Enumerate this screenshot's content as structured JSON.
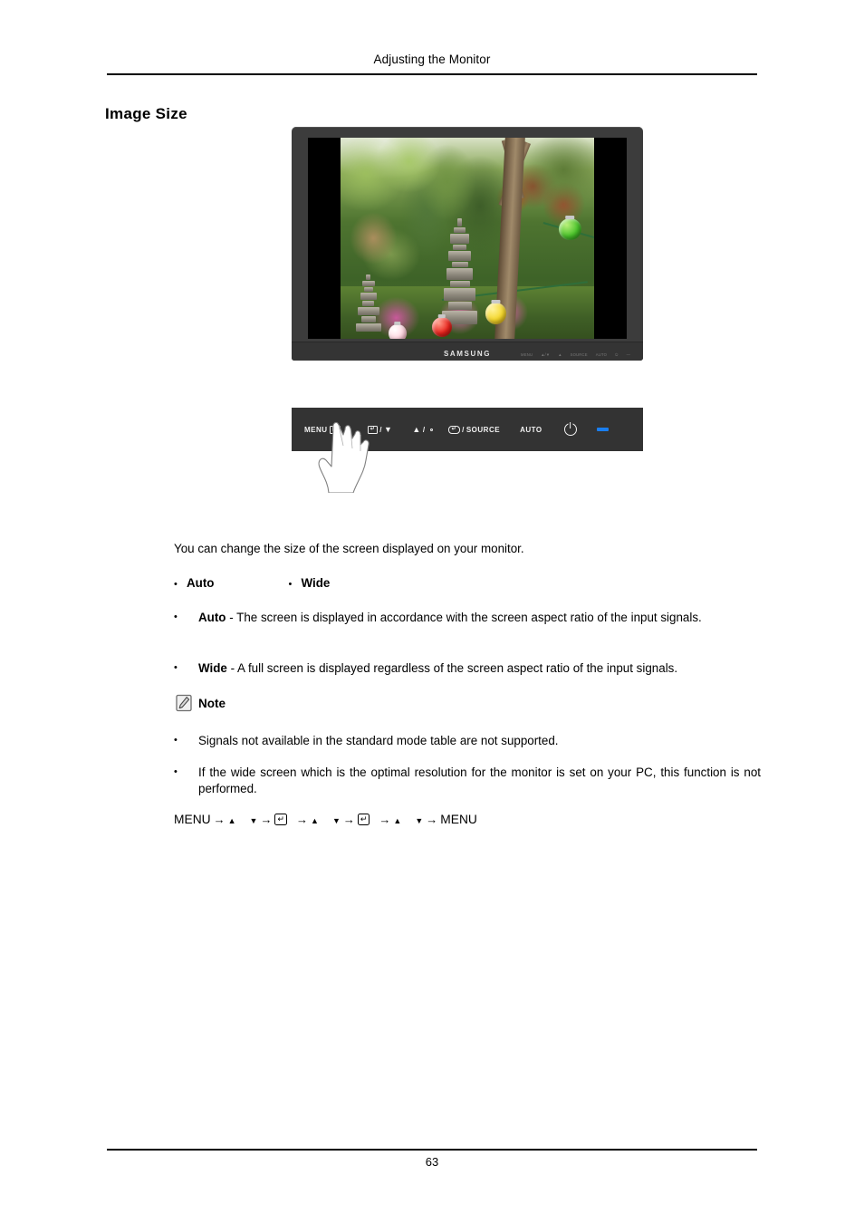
{
  "header": {
    "title": "Adjusting the Monitor"
  },
  "section": {
    "title": "Image Size"
  },
  "monitor": {
    "brand_logo": "SAMSUNG",
    "bezel_control_labels": [
      "MENU",
      "AUTO",
      "SOURCE",
      "PWR"
    ],
    "photo_description": "Korean temple garden with stone pagodas, trees and colorful paper lanterns"
  },
  "control_panel": {
    "buttons": [
      {
        "name": "menu-button",
        "label": "MENU",
        "glyph": "menu-grid-icon"
      },
      {
        "name": "enter-down-button",
        "label": "",
        "glyph_left": "enter-box-icon",
        "separator": "/",
        "glyph_right": "triangle-down-icon"
      },
      {
        "name": "up-brightness-button",
        "label": "",
        "glyph_left": "triangle-up-icon",
        "separator": "/",
        "glyph_right": "brightness-sun-icon"
      },
      {
        "name": "source-button",
        "label": "SOURCE",
        "glyph": "enter-pill-icon",
        "separator": "/"
      },
      {
        "name": "auto-button",
        "label": "AUTO",
        "glyph": ""
      },
      {
        "name": "power-button",
        "label": "",
        "glyph": "power-icon"
      },
      {
        "name": "power-led",
        "label": "",
        "glyph": "led-indicator",
        "color": "#1a7ef0"
      }
    ],
    "pointer": "hand-pointing-icon",
    "background_color": "#333333"
  },
  "content": {
    "intro": "You can change the size of the screen displayed on your monitor.",
    "options": [
      {
        "bullet": "•",
        "label": "Auto"
      },
      {
        "bullet": "•",
        "label": "Wide"
      }
    ],
    "descriptions": [
      {
        "bullet": "•",
        "term": "Auto",
        "text": " - The screen is displayed in accordance with the screen aspect ratio of the input signals."
      },
      {
        "bullet": "•",
        "term": "Wide",
        "text": " - A full screen is displayed regardless of the screen aspect ratio of the input signals."
      }
    ],
    "note": {
      "icon": "note-pencil-icon",
      "label": "Note",
      "items": [
        {
          "bullet": "•",
          "text": "Signals not available in the standard mode table are not supported."
        },
        {
          "bullet": "•",
          "text": "If the wide screen which is the optimal resolution for the monitor is set on your PC, this function is not performed."
        }
      ]
    },
    "menu_path": {
      "start": "MENU",
      "end": "MENU",
      "arrow": "→",
      "up": "▲",
      "down": "▼",
      "enter": "↵"
    }
  },
  "footer": {
    "page_number": "63"
  }
}
